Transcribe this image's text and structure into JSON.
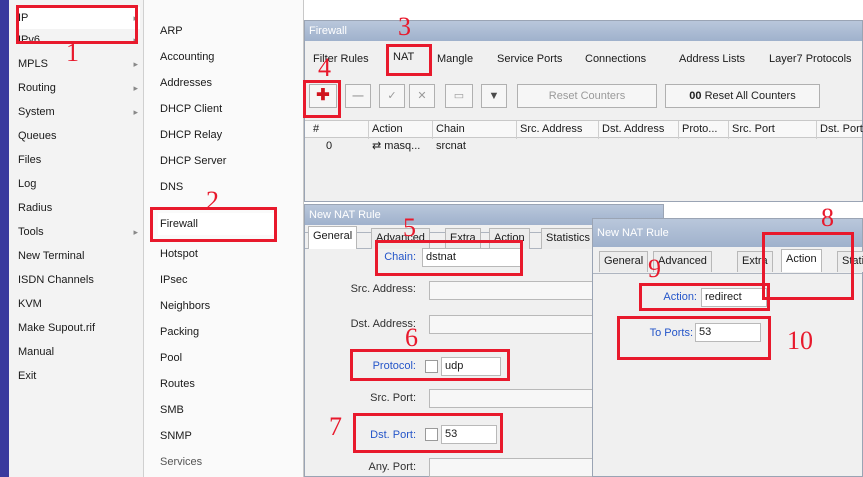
{
  "left_menu": {
    "items": [
      {
        "label": "IP",
        "arrow": true
      },
      {
        "label": "IPv6",
        "arrow": true
      },
      {
        "label": "MPLS",
        "arrow": true
      },
      {
        "label": "Routing",
        "arrow": true
      },
      {
        "label": "System",
        "arrow": true
      },
      {
        "label": "Queues",
        "arrow": false
      },
      {
        "label": "Files",
        "arrow": false
      },
      {
        "label": "Log",
        "arrow": false
      },
      {
        "label": "Radius",
        "arrow": false
      },
      {
        "label": "Tools",
        "arrow": true
      },
      {
        "label": "New Terminal",
        "arrow": false
      },
      {
        "label": "ISDN Channels",
        "arrow": false
      },
      {
        "label": "KVM",
        "arrow": false
      },
      {
        "label": "Make Supout.rif",
        "arrow": false
      },
      {
        "label": "Manual",
        "arrow": false
      },
      {
        "label": "Exit",
        "arrow": false
      }
    ],
    "arrow_glyph": "▸"
  },
  "ip_submenu": {
    "items": [
      "ARP",
      "Accounting",
      "Addresses",
      "DHCP Client",
      "DHCP Relay",
      "DHCP Server",
      "DNS",
      "Firewall",
      "Hotspot",
      "IPsec",
      "Neighbors",
      "Packing",
      "Pool",
      "Routes",
      "SMB",
      "SNMP",
      "Services"
    ]
  },
  "firewall": {
    "title": "Firewall",
    "tabs": [
      "Filter Rules",
      "NAT",
      "Mangle",
      "Service Ports",
      "Connections",
      "Address Lists",
      "Layer7 Protocols"
    ],
    "toolbar": {
      "add_glyph": "✚",
      "remove_glyph": "—",
      "enable_glyph": "✓",
      "disable_glyph": "✕",
      "comment_glyph": "▭",
      "filter_glyph": "▼",
      "reset_counters": "Reset Counters",
      "reset_all_counters": "Reset All Counters",
      "reset_all_prefix": "00"
    },
    "table": {
      "headers": [
        "#",
        "Action",
        "Chain",
        "Src. Address",
        "Dst. Address",
        "Proto...",
        "Src. Port",
        "Dst. Port"
      ],
      "rows": [
        [
          "0",
          "masq...",
          "srcnat",
          "",
          "",
          "",
          "",
          ""
        ]
      ],
      "row_icon": "⇄"
    }
  },
  "nat_rule_general": {
    "title": "New NAT Rule",
    "tabs": [
      "General",
      "Advanced",
      "Extra",
      "Action",
      "Statistics"
    ],
    "fields": {
      "chain_label": "Chain:",
      "chain_value": "dstnat",
      "src_address_label": "Src. Address:",
      "dst_address_label": "Dst. Address:",
      "protocol_label": "Protocol:",
      "protocol_value": "udp",
      "src_port_label": "Src. Port:",
      "dst_port_label": "Dst. Port:",
      "dst_port_value": "53",
      "any_port_label": "Any. Port:"
    }
  },
  "nat_rule_action": {
    "title": "New NAT Rule",
    "tabs": [
      "General",
      "Advanced",
      "Extra",
      "Action",
      "Statistics"
    ],
    "fields": {
      "action_label": "Action:",
      "action_value": "redirect",
      "to_ports_label": "To Ports:",
      "to_ports_value": "53"
    }
  },
  "annotations": [
    "1",
    "2",
    "3",
    "4",
    "5",
    "6",
    "7",
    "8",
    "9",
    "10"
  ],
  "colors": {
    "highlight": "#e8192c",
    "label_blue": "#2455c9",
    "title_bar": "#9fb1cc"
  }
}
